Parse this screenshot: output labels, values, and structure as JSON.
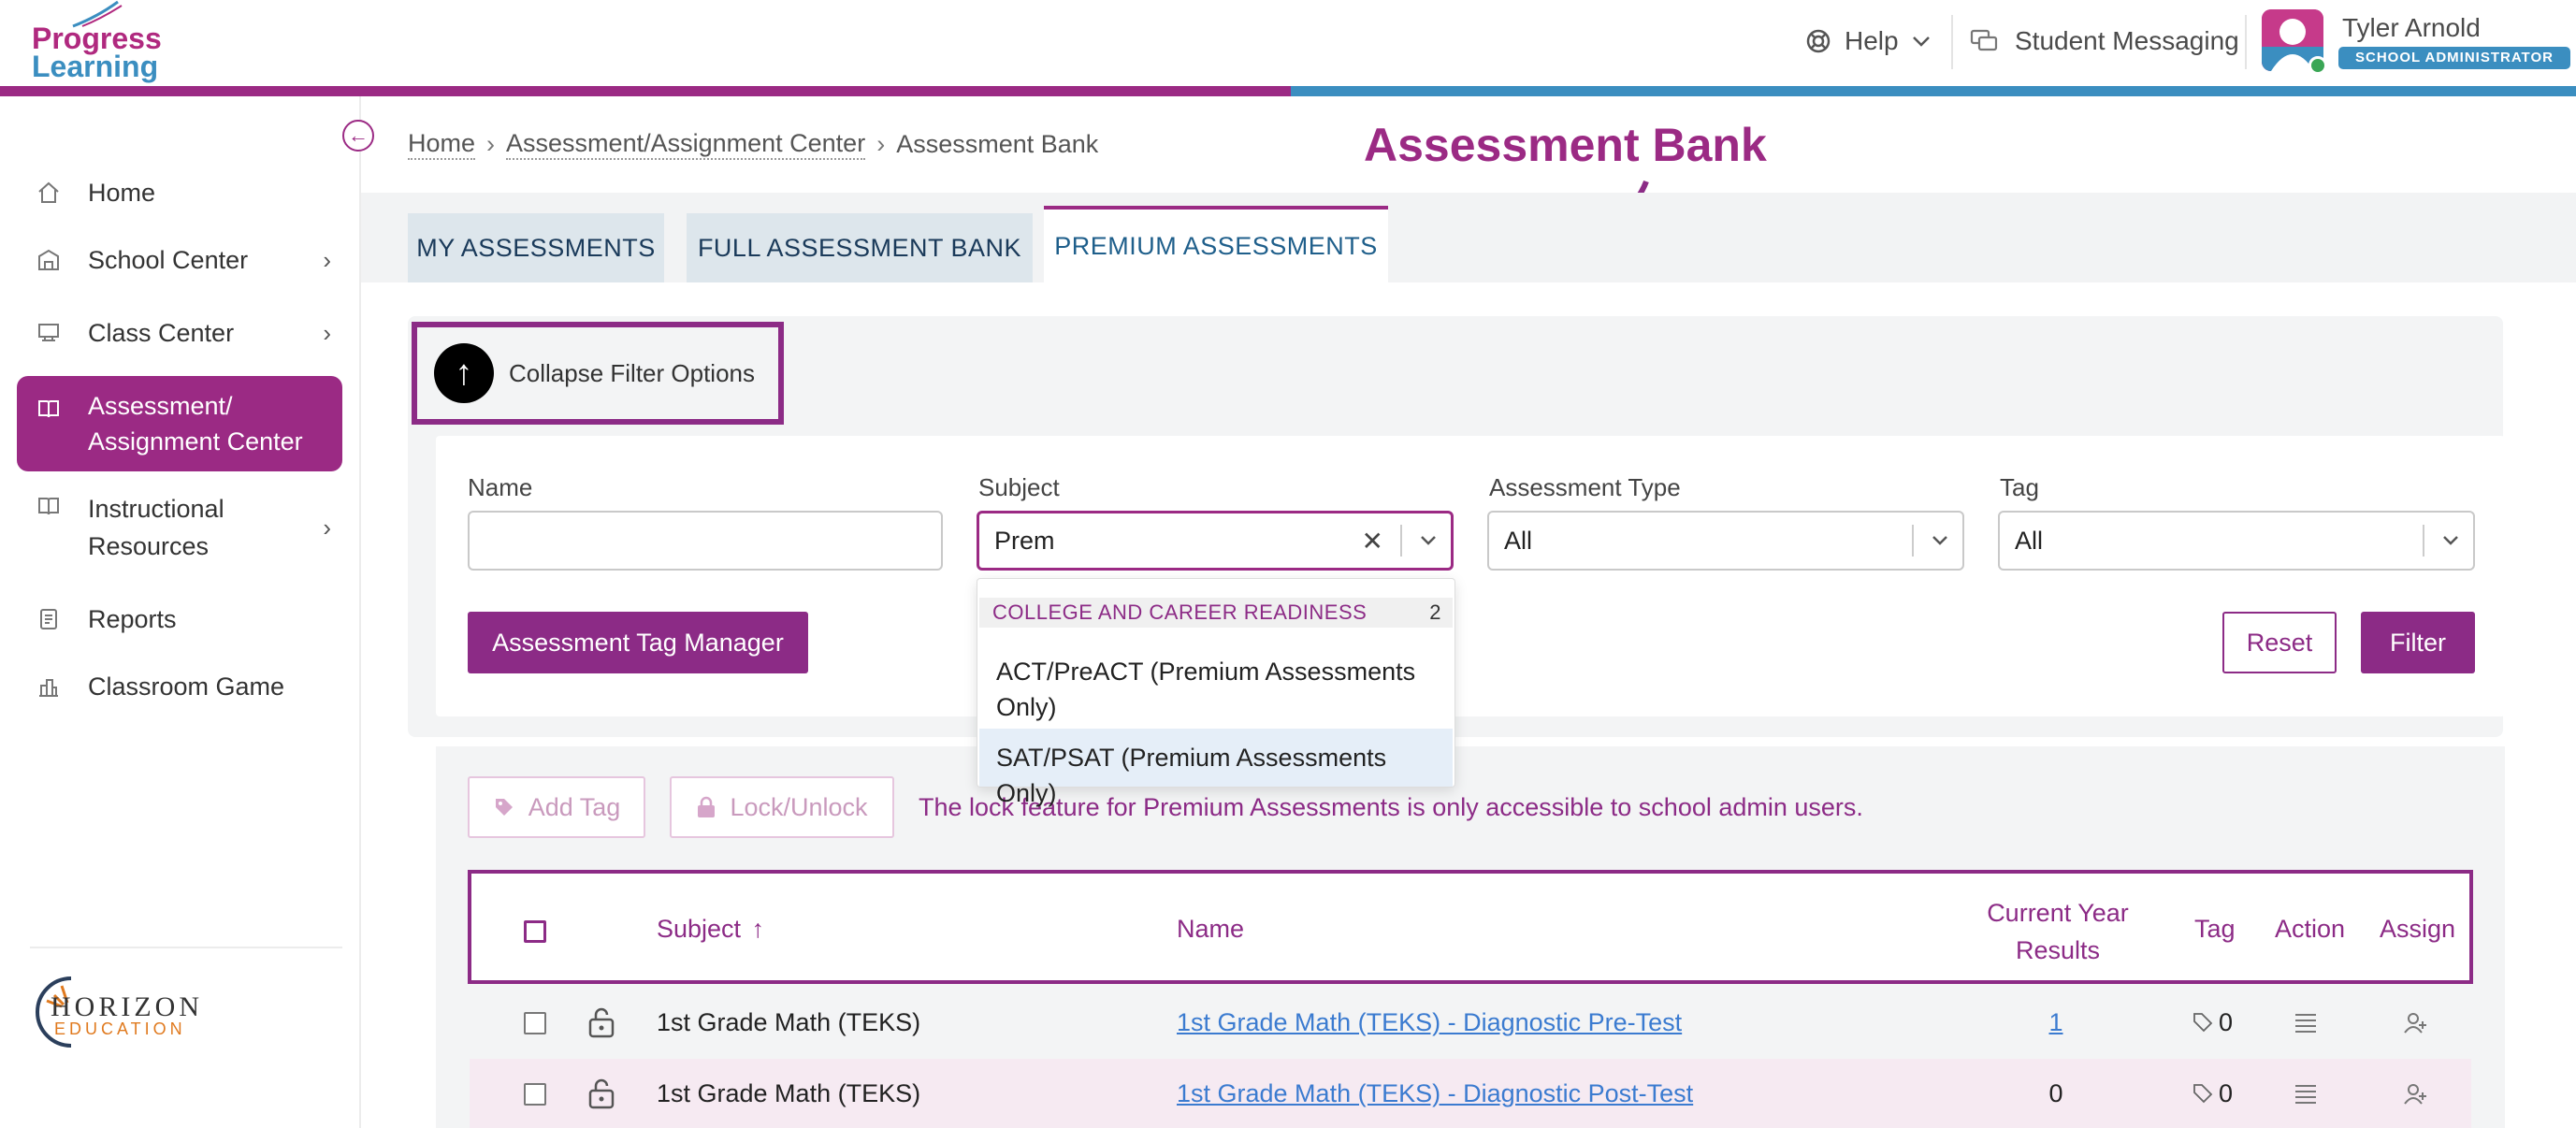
{
  "header": {
    "logo_line1": "Progress",
    "logo_line2": "Learning",
    "help_label": "Help",
    "messaging_label": "Student Messaging",
    "user_name": "Tyler Arnold",
    "user_role": "SCHOOL ADMINISTRATOR"
  },
  "sidebar": {
    "items": [
      {
        "label": "Home",
        "icon": "home-icon"
      },
      {
        "label": "School Center",
        "icon": "school-icon"
      },
      {
        "label": "Class Center",
        "icon": "class-icon"
      },
      {
        "label_line1": "Assessment/",
        "label_line2": "Assignment Center",
        "icon": "book-icon"
      },
      {
        "label_line1": "Instructional",
        "label_line2": "Resources",
        "icon": "resources-icon"
      },
      {
        "label": "Reports",
        "icon": "reports-icon"
      },
      {
        "label": "Classroom Game",
        "icon": "game-icon"
      }
    ],
    "footer_logo_line1": "HORIZON",
    "footer_logo_line2": "EDUCATION"
  },
  "breadcrumb": {
    "home": "Home",
    "center": "Assessment/Assignment Center",
    "current": "Assessment Bank"
  },
  "annotation_title": "Assessment Bank",
  "tabs": [
    {
      "label": "MY ASSESSMENTS"
    },
    {
      "label": "FULL ASSESSMENT BANK"
    },
    {
      "label": "PREMIUM ASSESSMENTS"
    }
  ],
  "filters": {
    "collapse_label": "Collapse Filter Options",
    "name_label": "Name",
    "name_value": "",
    "subject_label": "Subject",
    "subject_value": "Prem",
    "type_label": "Assessment Type",
    "type_value": "All",
    "tag_label": "Tag",
    "tag_value": "All",
    "tag_manager_button": "Assessment Tag Manager",
    "reset_button": "Reset",
    "filter_button": "Filter"
  },
  "dropdown": {
    "group_label": "COLLEGE AND CAREER READINESS",
    "group_count": "2",
    "option1_line1": "ACT/PreACT (Premium Assessments",
    "option1_line2": "Only)",
    "option2": "SAT/PSAT (Premium Assessments Only)"
  },
  "table": {
    "add_tag_button": "Add Tag",
    "lock_button": "Lock/Unlock",
    "lock_message": "The lock feature for Premium Assessments is only accessible to school admin users.",
    "headers": {
      "subject": "Subject",
      "name": "Name",
      "results_line1": "Current Year",
      "results_line2": "Results",
      "tag": "Tag",
      "action": "Action",
      "assign": "Assign"
    },
    "rows": [
      {
        "subject": "1st Grade Math (TEKS)",
        "name": "1st Grade Math (TEKS) - Diagnostic Pre-Test",
        "results": "1",
        "tag_count": "0"
      },
      {
        "subject": "1st Grade Math (TEKS)",
        "name": "1st Grade Math (TEKS) - Diagnostic Post-Test",
        "results": "0",
        "tag_count": "0"
      }
    ]
  },
  "colors": {
    "brand_purple": "#8c2b86",
    "brand_blue": "#3b8ec0",
    "link_blue": "#3b7bd0"
  }
}
